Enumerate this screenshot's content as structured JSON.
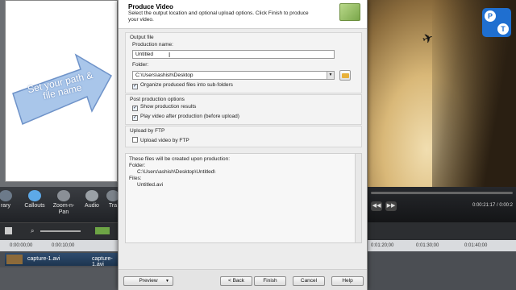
{
  "dialog": {
    "title": "Produce Video",
    "subtitle": "Select the output location and optional upload options. Click Finish to produce your video.",
    "output_group_title": "Output file",
    "production_name_label": "Production name:",
    "production_name_value": "Untitled",
    "folder_label": "Folder:",
    "folder_value": "C:\\Users\\ashish\\Desktop",
    "organize_label": "Organize produced files into sub-folders",
    "organize_checked": true,
    "post_group_title": "Post production options",
    "show_results_label": "Show production results",
    "show_results_checked": true,
    "play_after_label": "Play video after production (before upload)",
    "play_after_checked": true,
    "ftp_group_title": "Upload by FTP",
    "ftp_label": "Upload video by FTP",
    "ftp_checked": false,
    "summary": {
      "intro": "These files will be created upon production:",
      "folder_label": "Folder:",
      "folder_path": "C:\\Users\\ashish\\Desktop\\Untitled\\",
      "files_label": "Files:",
      "file_name": "Untitled.avi"
    },
    "buttons": {
      "preview": "Preview",
      "back": "< Back",
      "finish": "Finish",
      "cancel": "Cancel",
      "help": "Help"
    }
  },
  "overlay": {
    "arrow_text": "Set your path & file name"
  },
  "editor": {
    "tools": [
      "rary",
      "Callouts",
      "Zoom-n-Pan",
      "Audio",
      "Tra"
    ],
    "ruler_ticks": [
      "0:00:00;00",
      "0:00:10;00"
    ],
    "clip_left": "capture-1.avi",
    "clip_right": "capture-1.avi"
  },
  "preview_player": {
    "time": "0:00:21:17 / 0:00:2",
    "ruler_ticks": [
      "0:01:20;00",
      "0:01:30;00",
      "0:01:40;00"
    ]
  },
  "logo": {
    "letters": [
      "P",
      "T"
    ],
    "color": "#1f6fd0"
  }
}
